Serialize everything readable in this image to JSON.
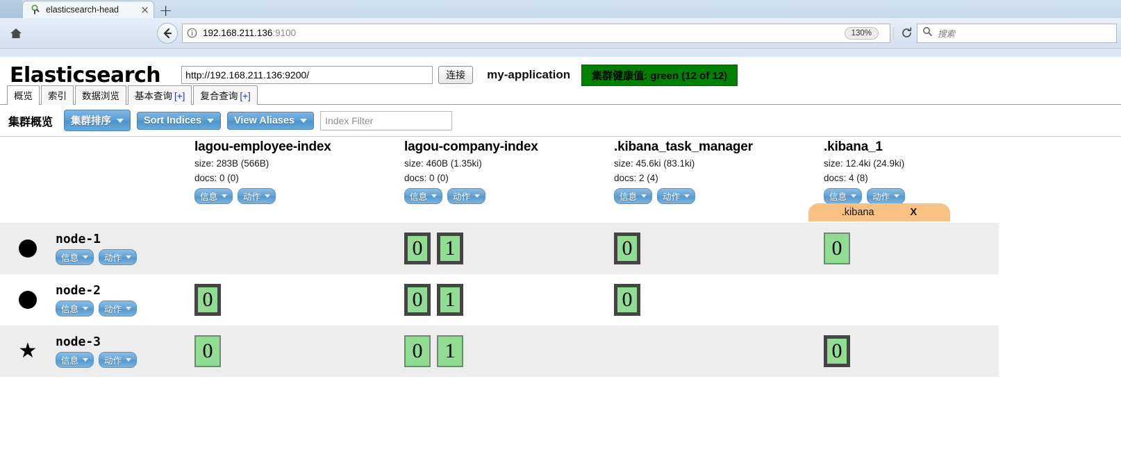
{
  "browser": {
    "tab": {
      "title": "elasticsearch-head",
      "favicon": "elasticsearch-favicon",
      "close_label": "×"
    },
    "new_tab_label": "+",
    "url": {
      "host": "192.168.211.136",
      "port": ":9100"
    },
    "zoom_level": "130%",
    "search_placeholder": "搜索"
  },
  "app": {
    "brand": "Elasticsearch",
    "connection_url": "http://192.168.211.136:9200/",
    "connect_button": "连接",
    "cluster_name": "my-application",
    "health_badge": "集群健康值: green (12 of 12)",
    "health_color": "#008000",
    "tabs": [
      {
        "label": "概览",
        "plus": "",
        "active": true
      },
      {
        "label": "索引",
        "plus": "",
        "active": false
      },
      {
        "label": "数据浏览",
        "plus": "",
        "active": false
      },
      {
        "label": "基本查询",
        "plus": "[+]",
        "active": false
      },
      {
        "label": "复合查询",
        "plus": "[+]",
        "active": false
      }
    ],
    "toolbar": {
      "title": "集群概览",
      "sort_cluster": "集群排序",
      "sort_indices": "Sort Indices",
      "view_aliases": "View Aliases",
      "index_filter_placeholder": "Index Filter",
      "index_filter_value": ""
    }
  },
  "cluster": {
    "info_label": "信息",
    "action_label": "动作",
    "indices": [
      {
        "name": "lagou-employee-index",
        "size": "size: 283B (566B)",
        "docs": "docs: 0 (0)"
      },
      {
        "name": "lagou-company-index",
        "size": "size: 460B (1.35ki)",
        "docs": "docs: 0 (0)"
      },
      {
        "name": ".kibana_task_manager",
        "size": "size: 45.6ki (83.1ki)",
        "docs": "docs: 2 (4)"
      },
      {
        "name": ".kibana_1",
        "size": "size: 12.4ki (24.9ki)",
        "docs": "docs: 4 (8)"
      }
    ],
    "alias": {
      "name": ".kibana",
      "close": "X",
      "color": "#f9c183",
      "column": 3
    },
    "nodes": [
      {
        "name": "node-1",
        "marker": "circle",
        "shards": [
          [],
          [
            {
              "label": "0",
              "kind": "primary"
            },
            {
              "label": "1",
              "kind": "primary"
            }
          ],
          [
            {
              "label": "0",
              "kind": "primary"
            }
          ],
          [
            {
              "label": "0",
              "kind": "replica"
            }
          ]
        ]
      },
      {
        "name": "node-2",
        "marker": "circle",
        "shards": [
          [
            {
              "label": "0",
              "kind": "primary"
            }
          ],
          [
            {
              "label": "0",
              "kind": "primary"
            },
            {
              "label": "1",
              "kind": "primary"
            }
          ],
          [
            {
              "label": "0",
              "kind": "primary"
            }
          ],
          []
        ]
      },
      {
        "name": "node-3",
        "marker": "star",
        "shards": [
          [
            {
              "label": "0",
              "kind": "replica"
            }
          ],
          [
            {
              "label": "0",
              "kind": "replica"
            },
            {
              "label": "1",
              "kind": "replica"
            }
          ],
          [],
          [
            {
              "label": "0",
              "kind": "primary"
            }
          ]
        ]
      }
    ]
  }
}
